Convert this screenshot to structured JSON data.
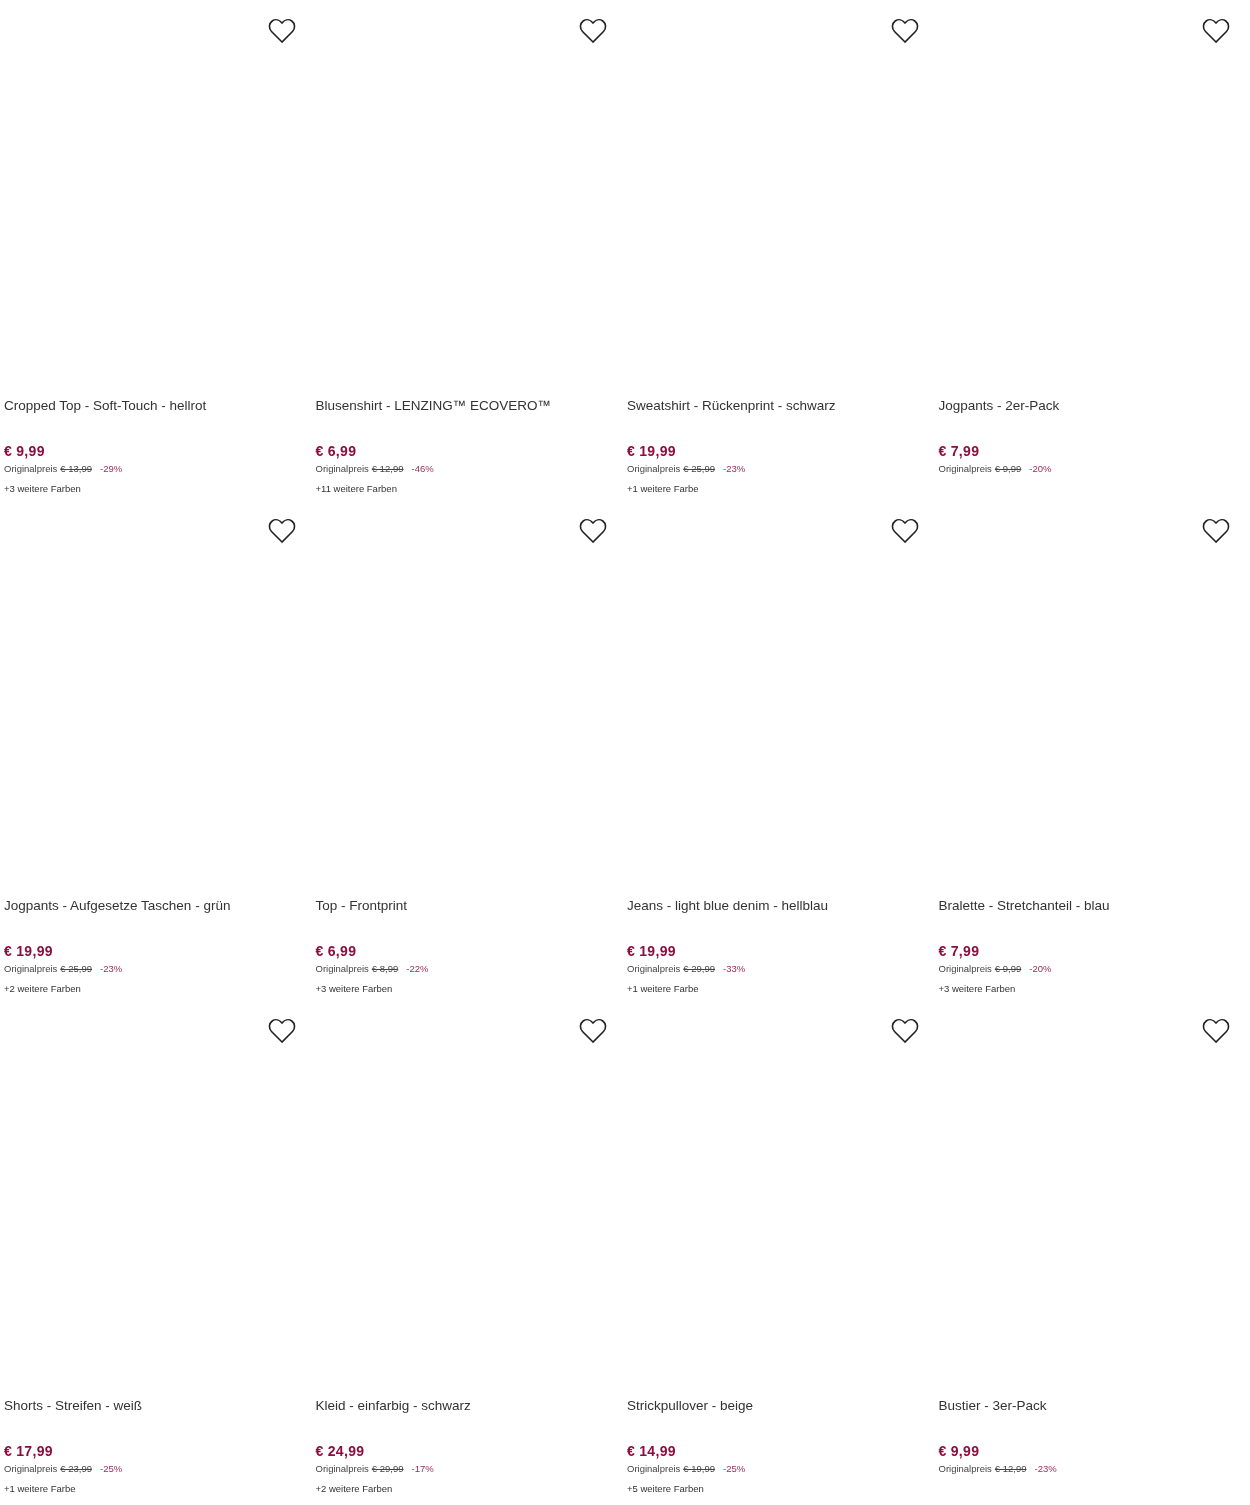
{
  "products": [
    {
      "title": "Cropped Top - Soft-Touch - hellrot",
      "price": "€ 9,99",
      "original_label": "Originalpreis",
      "original_price": "€ 13,99",
      "discount": "-29%",
      "colors": "+3 weitere Farben"
    },
    {
      "title": "Blusenshirt - LENZING™ ECOVERO™",
      "price": "€ 6,99",
      "original_label": "Originalpreis",
      "original_price": "€ 12,99",
      "discount": "-46%",
      "colors": "+11 weitere Farben"
    },
    {
      "title": "Sweatshirt - Rückenprint - schwarz",
      "price": "€ 19,99",
      "original_label": "Originalpreis",
      "original_price": "€ 25,99",
      "discount": "-23%",
      "colors": "+1 weitere Farbe"
    },
    {
      "title": "Jogpants - 2er-Pack",
      "price": "€ 7,99",
      "original_label": "Originalpreis",
      "original_price": "€ 9,99",
      "discount": "-20%"
    },
    {
      "title": "Jogpants - Aufgesetze Taschen - grün",
      "price": "€ 19,99",
      "original_label": "Originalpreis",
      "original_price": "€ 25,99",
      "discount": "-23%",
      "colors": "+2 weitere Farben"
    },
    {
      "title": "Top - Frontprint",
      "price": "€ 6,99",
      "original_label": "Originalpreis",
      "original_price": "€ 8,99",
      "discount": "-22%",
      "colors": "+3 weitere Farben"
    },
    {
      "title": "Jeans - light blue denim - hellblau",
      "price": "€ 19,99",
      "original_label": "Originalpreis",
      "original_price": "€ 29,99",
      "discount": "-33%",
      "colors": "+1 weitere Farbe"
    },
    {
      "title": "Bralette - Stretchanteil - blau",
      "price": "€ 7,99",
      "original_label": "Originalpreis",
      "original_price": "€ 9,99",
      "discount": "-20%",
      "colors": "+3 weitere Farben"
    },
    {
      "title": "Shorts - Streifen - weiß",
      "price": "€ 17,99",
      "original_label": "Originalpreis",
      "original_price": "€ 23,99",
      "discount": "-25%",
      "colors": "+1 weitere Farbe"
    },
    {
      "title": "Kleid - einfarbig - schwarz",
      "price": "€ 24,99",
      "original_label": "Originalpreis",
      "original_price": "€ 29,99",
      "discount": "-17%",
      "colors": "+2 weitere Farben"
    },
    {
      "title": "Strickpullover - beige",
      "price": "€ 14,99",
      "original_label": "Originalpreis",
      "original_price": "€ 19,99",
      "discount": "-25%",
      "colors": "+5 weitere Farben"
    },
    {
      "title": "Bustier - 3er-Pack",
      "price": "€ 9,99",
      "original_label": "Originalpreis",
      "original_price": "€ 12,99",
      "discount": "-23%"
    }
  ]
}
